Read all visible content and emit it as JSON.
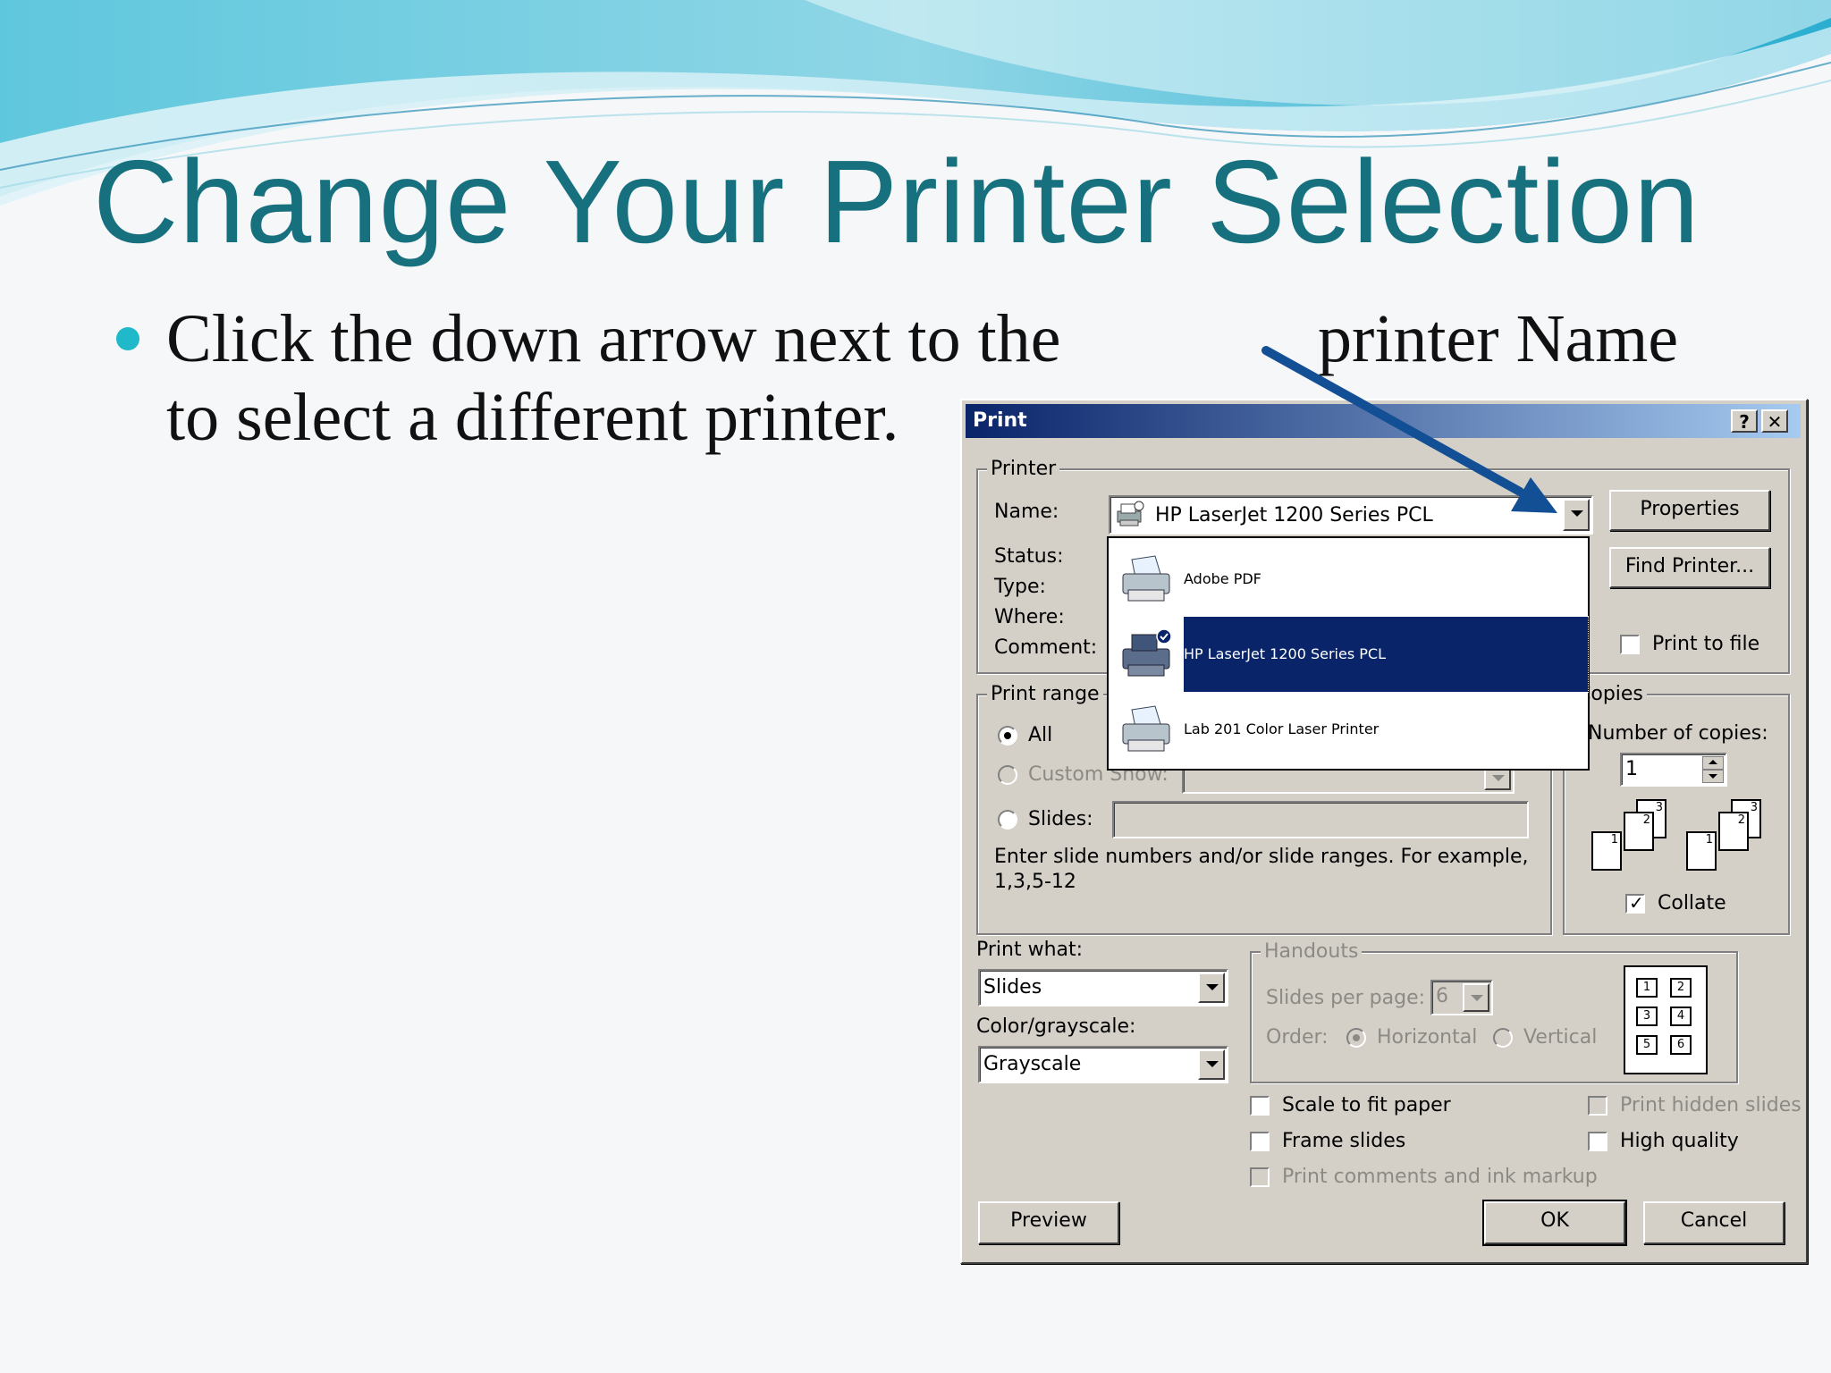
{
  "slide": {
    "title": "Change Your Printer Selection",
    "bullet_line1_a": "Click the down arrow next to the",
    "bullet_line1_b": "printer Name",
    "bullet_line2": "to select a different printer."
  },
  "dialog": {
    "title": "Print",
    "help_button": "?",
    "close_button": "✕",
    "printer_group": "Printer",
    "name_label": "Name:",
    "name_value": "HP LaserJet 1200 Series PCL",
    "status_label": "Status:",
    "type_label": "Type:",
    "where_label": "Where:",
    "comment_label": "Comment:",
    "properties_button": "Properties",
    "find_printer_button": "Find Printer...",
    "print_to_file": "Print to file",
    "printer_options": [
      {
        "label": "Adobe PDF",
        "selected": false
      },
      {
        "label": "HP LaserJet 1200 Series PCL",
        "selected": true
      },
      {
        "label": "Lab 201 Color Laser Printer",
        "selected": false
      }
    ],
    "print_range_group": "Print range",
    "range_all": "All",
    "range_custom_show": "Custom Show:",
    "range_slides": "Slides:",
    "range_hint_line1": "Enter slide numbers and/or slide ranges. For example,",
    "range_hint_line2": "1,3,5-12",
    "copies_group": "Copies",
    "copies_label": "Number of copies:",
    "copies_value": "1",
    "collate_label": "Collate",
    "collate_checked": true,
    "copies_pages": [
      "1",
      "2",
      "3"
    ],
    "print_what_label": "Print what:",
    "print_what_value": "Slides",
    "color_label": "Color/grayscale:",
    "color_value": "Grayscale",
    "handouts_group": "Handouts",
    "slides_per_page_label": "Slides per page:",
    "slides_per_page_value": "6",
    "order_label": "Order:",
    "order_horizontal": "Horizontal",
    "order_vertical": "Vertical",
    "handout_cells": [
      "1",
      "2",
      "3",
      "4",
      "5",
      "6"
    ],
    "scale_to_fit": "Scale to fit paper",
    "frame_slides": "Frame slides",
    "print_comments": "Print comments and ink markup",
    "print_hidden": "Print hidden slides",
    "high_quality": "High quality",
    "preview_button": "Preview",
    "ok_button": "OK",
    "cancel_button": "Cancel"
  },
  "colors": {
    "title_teal": "#17707e",
    "bullet": "#1fb9c9",
    "arrow": "#124f94",
    "selection": "#0a246a"
  }
}
